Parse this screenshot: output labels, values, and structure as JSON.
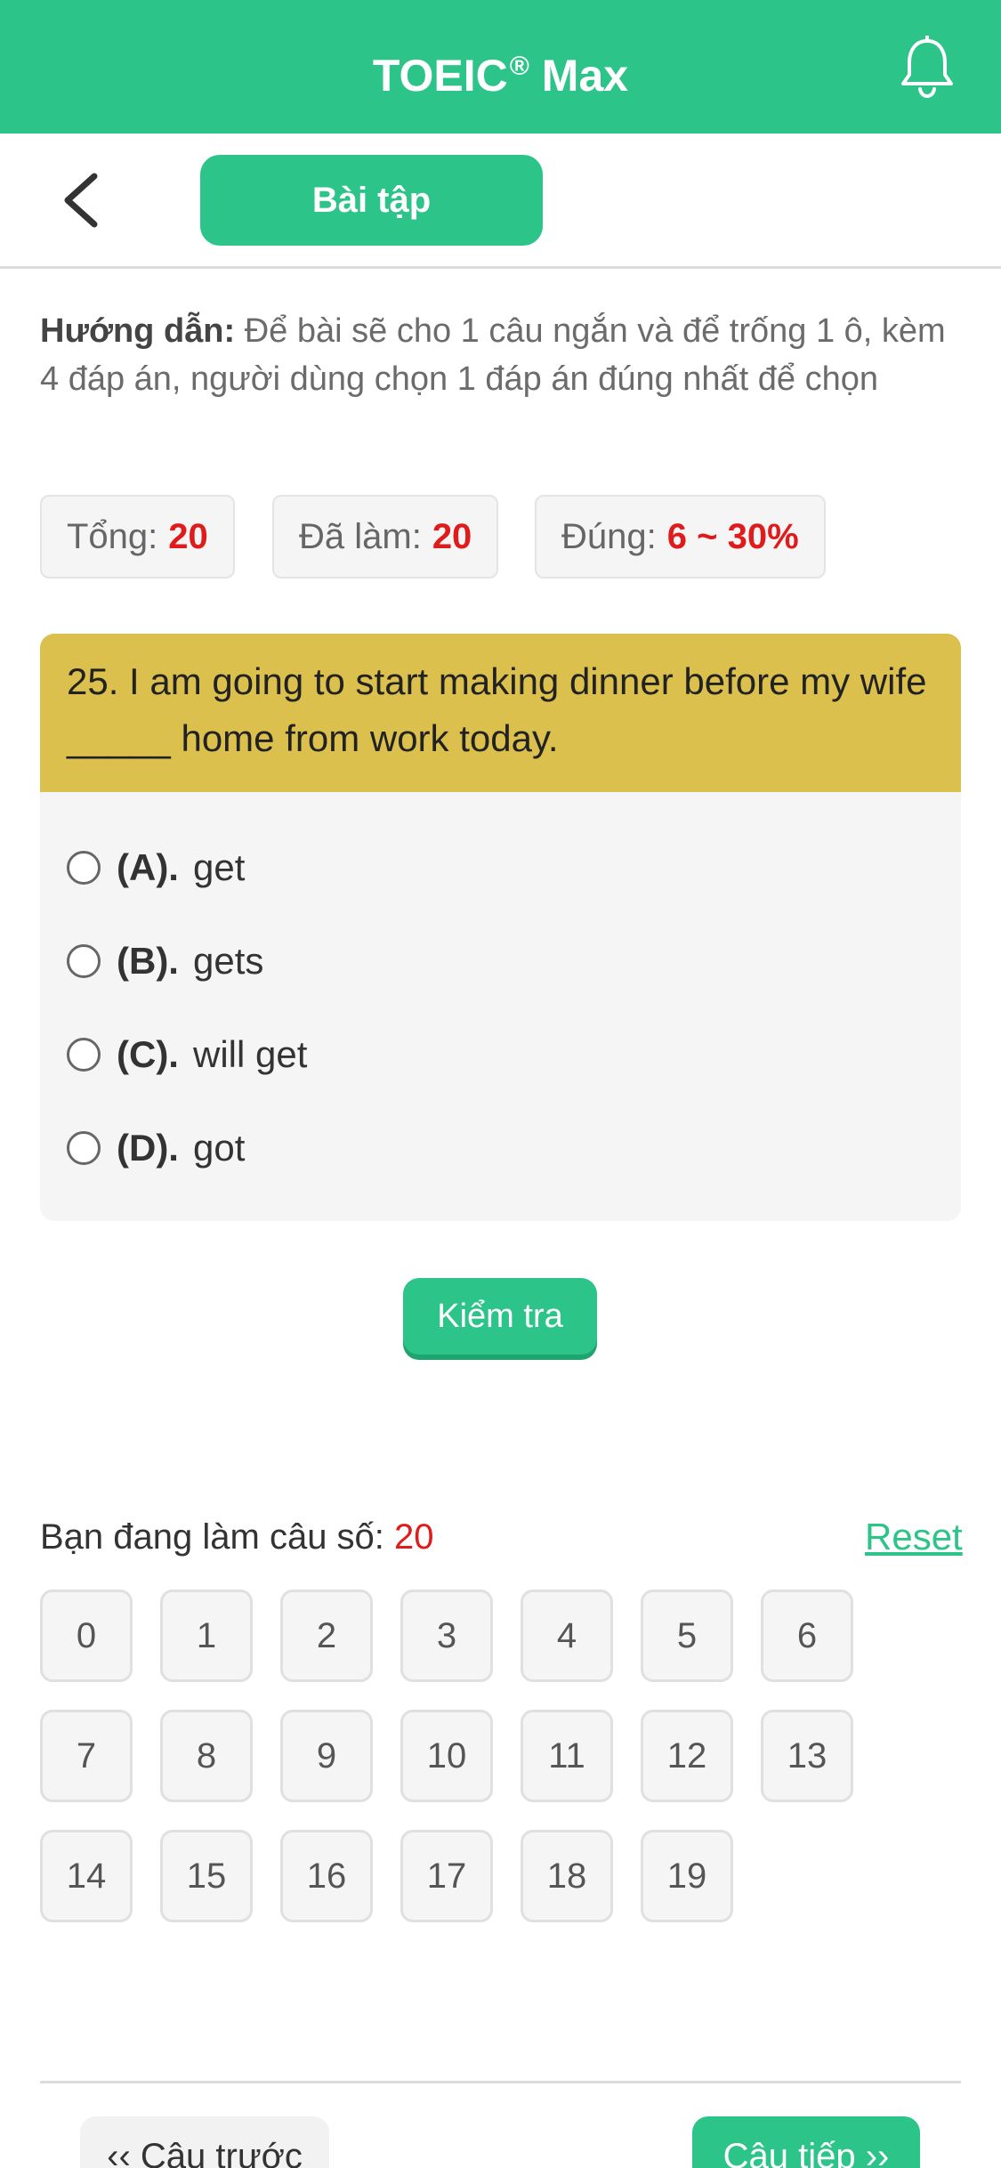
{
  "header": {
    "title": "TOEIC",
    "title_mark": "®",
    "title_suffix": " Max",
    "bell_icon": "bell-icon"
  },
  "nav": {
    "back_icon": "chevron-left-icon",
    "tab_label": "Bài tập"
  },
  "guide": {
    "label": "Hướng dẫn:",
    "text": " Để bài sẽ cho 1 câu ngắn và để trống 1 ô, kèm 4 đáp án, người dùng chọn 1 đáp án đúng nhất để chọn"
  },
  "stats": [
    {
      "label": "Tổng:",
      "value": "20"
    },
    {
      "label": "Đã làm:",
      "value": "20"
    },
    {
      "label": "Đúng:",
      "value": "6 ~ 30%"
    }
  ],
  "question": {
    "text": "25. I am going to start making dinner before my wife _____ home from work today.",
    "options": [
      {
        "label": "(A).",
        "text": "get"
      },
      {
        "label": "(B).",
        "text": "gets"
      },
      {
        "label": "(C).",
        "text": "will get"
      },
      {
        "label": "(D).",
        "text": "got"
      }
    ]
  },
  "check_button": "Kiểm tra",
  "progress": {
    "label": "Bạn đang làm câu số:",
    "value": "20",
    "reset": "Reset"
  },
  "numbers": [
    "0",
    "1",
    "2",
    "3",
    "4",
    "5",
    "6",
    "7",
    "8",
    "9",
    "10",
    "11",
    "12",
    "13",
    "14",
    "15",
    "16",
    "17",
    "18",
    "19"
  ],
  "footer": {
    "prev": "‹‹ Câu trước",
    "next": "Câu tiếp ››"
  },
  "colors": {
    "brand": "#2dc48a",
    "question_header": "#dcc04e",
    "highlight": "#e01b1b"
  }
}
